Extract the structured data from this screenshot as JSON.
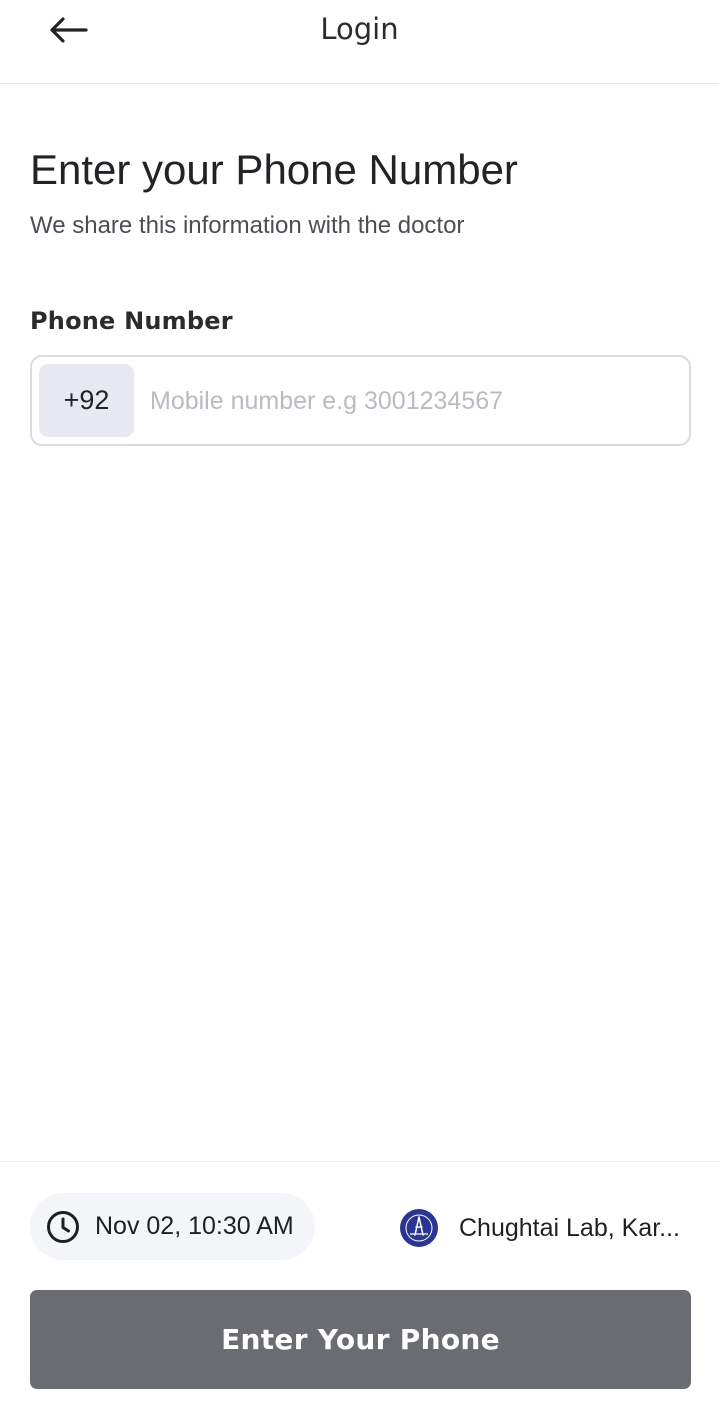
{
  "header": {
    "title": "Login",
    "back_icon": "arrow-left-icon"
  },
  "main": {
    "headline": "Enter your Phone Number",
    "subheadline": "We share this information with the doctor",
    "phone_field": {
      "label": "Phone Number",
      "country_code": "+92",
      "placeholder": "Mobile number e.g 3001234567",
      "value": ""
    }
  },
  "footer": {
    "appointment": {
      "icon": "clock-icon",
      "datetime": "Nov 02, 10:30 AM"
    },
    "lab": {
      "icon": "lab-logo",
      "name": "Chughtai Lab, Kar..."
    },
    "primary_button": {
      "label": "Enter Your Phone",
      "state": "disabled"
    }
  },
  "colors": {
    "button_disabled": "#6a6c71",
    "country_code_bg": "#e8e9f0",
    "chip_bg": "#f4f5f9",
    "lab_logo": "#2b3594",
    "border": "#dadbe0"
  }
}
